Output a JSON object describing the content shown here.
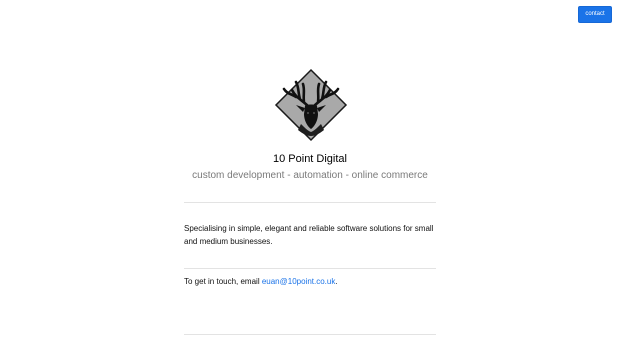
{
  "header": {
    "contact_label": "contact"
  },
  "brand": {
    "logo_icon": "stag-head-diamond-icon",
    "title": "10 Point Digital",
    "tagline": "custom development - automation - online commerce"
  },
  "content": {
    "description": "Specialising in simple, elegant and reliable software solutions for small and medium businesses.",
    "contact_prefix": "To get in touch, email ",
    "contact_email": "euan@10point.co.uk",
    "contact_suffix": "."
  },
  "colors": {
    "accent": "#1a73e8",
    "tagline": "#7a7a7a",
    "divider": "#e3e3e3"
  }
}
